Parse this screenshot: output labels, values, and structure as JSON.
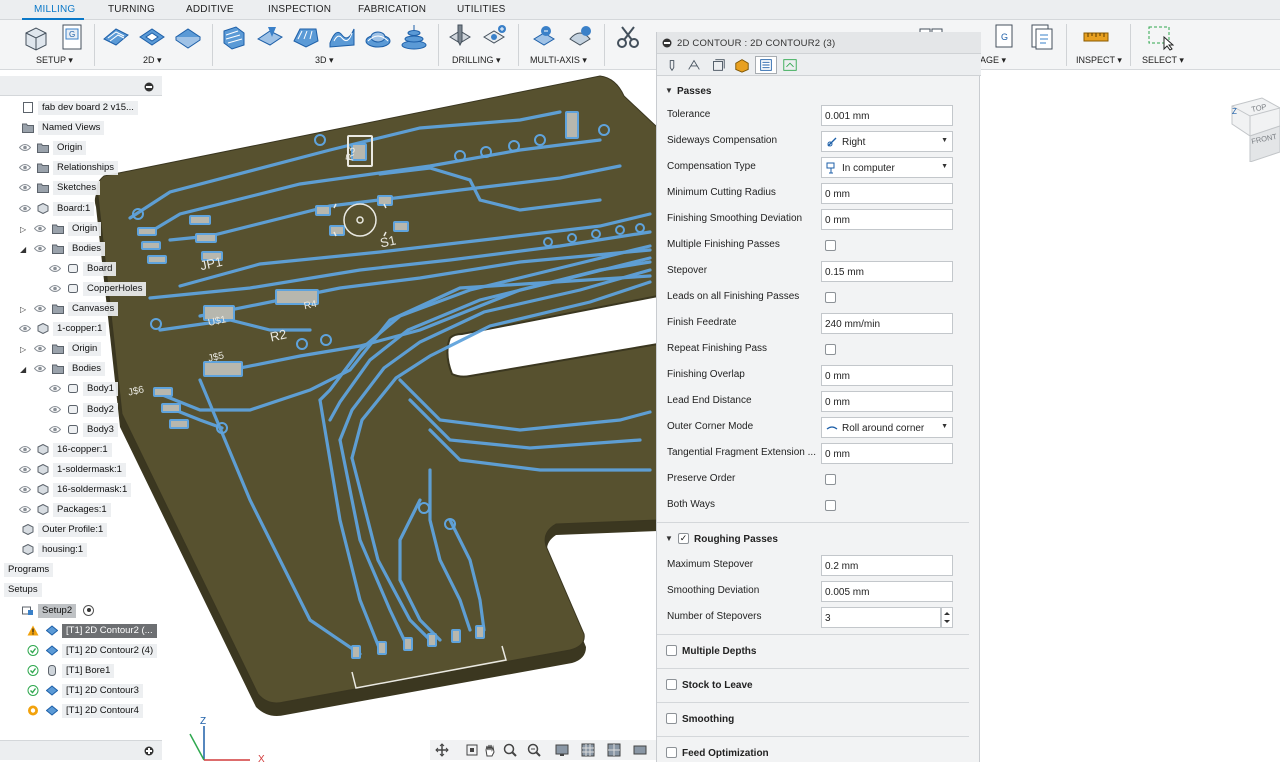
{
  "tabs": [
    "MILLING",
    "TURNING",
    "ADDITIVE",
    "INSPECTION",
    "FABRICATION",
    "UTILITIES"
  ],
  "ribbon": {
    "groups": {
      "setup": "SETUP",
      "two_d": "2D",
      "three_d": "3D",
      "drilling": "DRILLING",
      "multi_axis": "MULTI-AXIS",
      "manage": "AGE",
      "inspect": "INSPECT",
      "select": "SELECT"
    },
    "dropdown_marker": "▾",
    "tool_letter_g": "G"
  },
  "browser": {
    "items": [
      {
        "label": "fab dev board 2 v15...",
        "indent": 1,
        "icon": "document-icon",
        "eye": false,
        "arrow": ""
      },
      {
        "label": "Named Views",
        "indent": 1,
        "icon": "folder-icon",
        "eye": false,
        "arrow": ""
      },
      {
        "label": "Origin",
        "indent": 2,
        "icon": "folder-icon",
        "eye": true,
        "arrow": ""
      },
      {
        "label": "Relationships",
        "indent": 2,
        "icon": "folder-icon",
        "eye": true,
        "arrow": ""
      },
      {
        "label": "Sketches",
        "indent": 2,
        "icon": "folder-icon",
        "eye": true,
        "arrow": ""
      },
      {
        "label": "Board:1",
        "indent": 2,
        "icon": "component-icon",
        "eye": true,
        "arrow": ""
      },
      {
        "label": "Origin",
        "indent": 3,
        "icon": "folder-icon",
        "eye": true,
        "arrow": "▷"
      },
      {
        "label": "Bodies",
        "indent": 3,
        "icon": "folder-icon",
        "eye": true,
        "arrow": "◢"
      },
      {
        "label": "Board",
        "indent": 4,
        "icon": "body-icon",
        "eye": true,
        "arrow": ""
      },
      {
        "label": "CopperHoles",
        "indent": 4,
        "icon": "body-icon",
        "eye": true,
        "arrow": ""
      },
      {
        "label": "Canvases",
        "indent": 3,
        "icon": "folder-icon",
        "eye": true,
        "arrow": "▷"
      },
      {
        "label": "1-copper:1",
        "indent": 2,
        "icon": "component-icon",
        "eye": true,
        "arrow": ""
      },
      {
        "label": "Origin",
        "indent": 3,
        "icon": "folder-icon",
        "eye": true,
        "arrow": "▷"
      },
      {
        "label": "Bodies",
        "indent": 3,
        "icon": "folder-icon",
        "eye": true,
        "arrow": "◢"
      },
      {
        "label": "Body1",
        "indent": 4,
        "icon": "body-icon",
        "eye": true,
        "arrow": ""
      },
      {
        "label": "Body2",
        "indent": 4,
        "icon": "body-icon",
        "eye": true,
        "arrow": ""
      },
      {
        "label": "Body3",
        "indent": 4,
        "icon": "body-icon",
        "eye": true,
        "arrow": ""
      },
      {
        "label": "16-copper:1",
        "indent": 2,
        "icon": "component-icon",
        "eye": true,
        "arrow": ""
      },
      {
        "label": "1-soldermask:1",
        "indent": 2,
        "icon": "component-icon",
        "eye": true,
        "arrow": ""
      },
      {
        "label": "16-soldermask:1",
        "indent": 2,
        "icon": "component-icon",
        "eye": true,
        "arrow": ""
      },
      {
        "label": "Packages:1",
        "indent": 2,
        "icon": "component-icon",
        "eye": true,
        "arrow": ""
      },
      {
        "label": "Outer Profile:1",
        "indent": 1,
        "icon": "component-icon",
        "eye": false,
        "arrow": ""
      },
      {
        "label": "housing:1",
        "indent": 1,
        "icon": "component-icon",
        "eye": false,
        "arrow": ""
      },
      {
        "label": "Programs",
        "indent": 0,
        "icon": "",
        "eye": false,
        "arrow": ""
      },
      {
        "label": "Setups",
        "indent": 0,
        "icon": "",
        "eye": false,
        "arrow": ""
      },
      {
        "label": "Setup2",
        "indent": 1,
        "icon": "setup-icon",
        "eye": false,
        "arrow": "",
        "style": "hl2"
      },
      {
        "label": "[T1] 2D Contour2 (...",
        "indent": 2,
        "icon": "contour-icon",
        "eye": false,
        "arrow": "",
        "status": "warning",
        "style": "hl"
      },
      {
        "label": "[T1] 2D Contour2 (4)",
        "indent": 2,
        "icon": "contour-icon",
        "eye": false,
        "arrow": "",
        "status": "ok"
      },
      {
        "label": "[T1] Bore1",
        "indent": 2,
        "icon": "bore-icon",
        "eye": false,
        "arrow": "",
        "status": "ok"
      },
      {
        "label": "[T1] 2D Contour3",
        "indent": 2,
        "icon": "contour-icon",
        "eye": false,
        "arrow": "",
        "status": "ok"
      },
      {
        "label": "[T1] 2D Contour4",
        "indent": 2,
        "icon": "contour-icon",
        "eye": false,
        "arrow": "",
        "status": "pending"
      }
    ]
  },
  "pcb": {
    "labels": [
      {
        "text": "R3"
      },
      {
        "text": "S1"
      },
      {
        "text": "JP1"
      },
      {
        "text": "U$1"
      },
      {
        "text": "R4"
      },
      {
        "text": "R2"
      },
      {
        "text": "J$5"
      },
      {
        "text": "J$6"
      }
    ]
  },
  "panel": {
    "title": "2D CONTOUR : 2D CONTOUR2 (3)",
    "passes_title": "Passes",
    "rows": [
      {
        "label": "Tolerance",
        "kind": "field",
        "value": "0.001 mm"
      },
      {
        "label": "Sideways Compensation",
        "kind": "select",
        "value": "Right",
        "icon": "compensation-right-icon"
      },
      {
        "label": "Compensation Type",
        "kind": "select",
        "value": "In computer",
        "icon": "compensation-type-icon"
      },
      {
        "label": "Minimum Cutting Radius",
        "kind": "field",
        "value": "0 mm"
      },
      {
        "label": "Finishing Smoothing Deviation",
        "kind": "field",
        "value": "0 mm"
      },
      {
        "label": "Multiple Finishing Passes",
        "kind": "check",
        "value": ""
      },
      {
        "label": "Stepover",
        "kind": "field",
        "value": "0.15 mm"
      },
      {
        "label": "Leads on all Finishing Passes",
        "kind": "check",
        "value": ""
      },
      {
        "label": "Finish Feedrate",
        "kind": "field",
        "value": "240 mm/min"
      },
      {
        "label": "Repeat Finishing Pass",
        "kind": "check",
        "value": ""
      },
      {
        "label": "Finishing Overlap",
        "kind": "field",
        "value": "0 mm"
      },
      {
        "label": "Lead End Distance",
        "kind": "field",
        "value": "0 mm"
      },
      {
        "label": "Outer Corner Mode",
        "kind": "select",
        "value": "Roll around corner",
        "icon": "roll-corner-icon"
      },
      {
        "label": "Tangential Fragment Extension ...",
        "kind": "field",
        "value": "0 mm"
      },
      {
        "label": "Preserve Order",
        "kind": "check",
        "value": ""
      },
      {
        "label": "Both Ways",
        "kind": "check",
        "value": ""
      }
    ],
    "roughing": {
      "title": "Roughing Passes",
      "checked_mark": "✓",
      "rows": [
        {
          "label": "Maximum Stepover",
          "value": "0.2 mm"
        },
        {
          "label": "Smoothing Deviation",
          "value": "0.005 mm"
        },
        {
          "label": "Number of Stepovers",
          "value": "3"
        }
      ]
    },
    "sections": [
      "Multiple Depths",
      "Stock to Leave",
      "Smoothing",
      "Feed Optimization"
    ]
  },
  "viewcube": {
    "top": "TOP",
    "front": "FRONT"
  },
  "triad": {
    "z": "Z",
    "x": "X"
  },
  "colors": {
    "accent": "#0a78c8",
    "board": "#57512f",
    "trace": "#5fa3dc",
    "warning": "#f2a20c",
    "ok": "#2fa84f"
  }
}
